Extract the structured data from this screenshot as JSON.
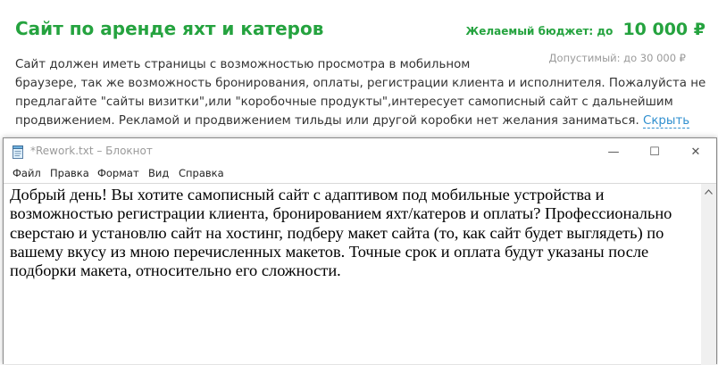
{
  "job": {
    "title": "Сайт по аренде яхт и катеров",
    "budget_label": "Желаемый бюджет: до",
    "budget_value": "10 000 ₽",
    "allowed_budget": "Допустимый: до 30 000 ₽",
    "description_lines": [
      "Сайт должен иметь страницы с возможностью просмотра в мобильном",
      "браузере, так же возможность бронирования, оплаты, регистрации клиента и исполнителя. Пожалуйста не",
      "предлагайте \"сайты визитки\",или \"коробочные продукты\",интересует самописный сайт с дальнейшим",
      "продвижением. Рекламой и продвижением тильды или другой коробки нет желания заниматься."
    ],
    "hide_link": "Скрыть"
  },
  "notepad": {
    "title": "*Rework.txt – Блокнот",
    "menu": [
      "Файл",
      "Правка",
      "Формат",
      "Вид",
      "Справка"
    ],
    "content_lines": [
      "Добрый день! Вы хотите самописный сайт с адаптивом под мобильные устройства и",
      "возможностью регистрации клиента, бронированием яхт/катеров и оплаты? Профессионально",
      "сверстаю и установлю сайт на хостинг, подберу макет сайта (то, как сайт будет выглядеть) по",
      "вашему вкусу из мною перечисленных макетов. Точные срок и оплата будут указаны после",
      "подборки макета, относительно его сложности."
    ],
    "window_buttons": {
      "minimize": "—",
      "maximize": "☐",
      "close": "✕"
    },
    "icon": "notepad-icon"
  },
  "colors": {
    "accent_green": "#25a33f",
    "link_blue": "#2f8fcf"
  }
}
